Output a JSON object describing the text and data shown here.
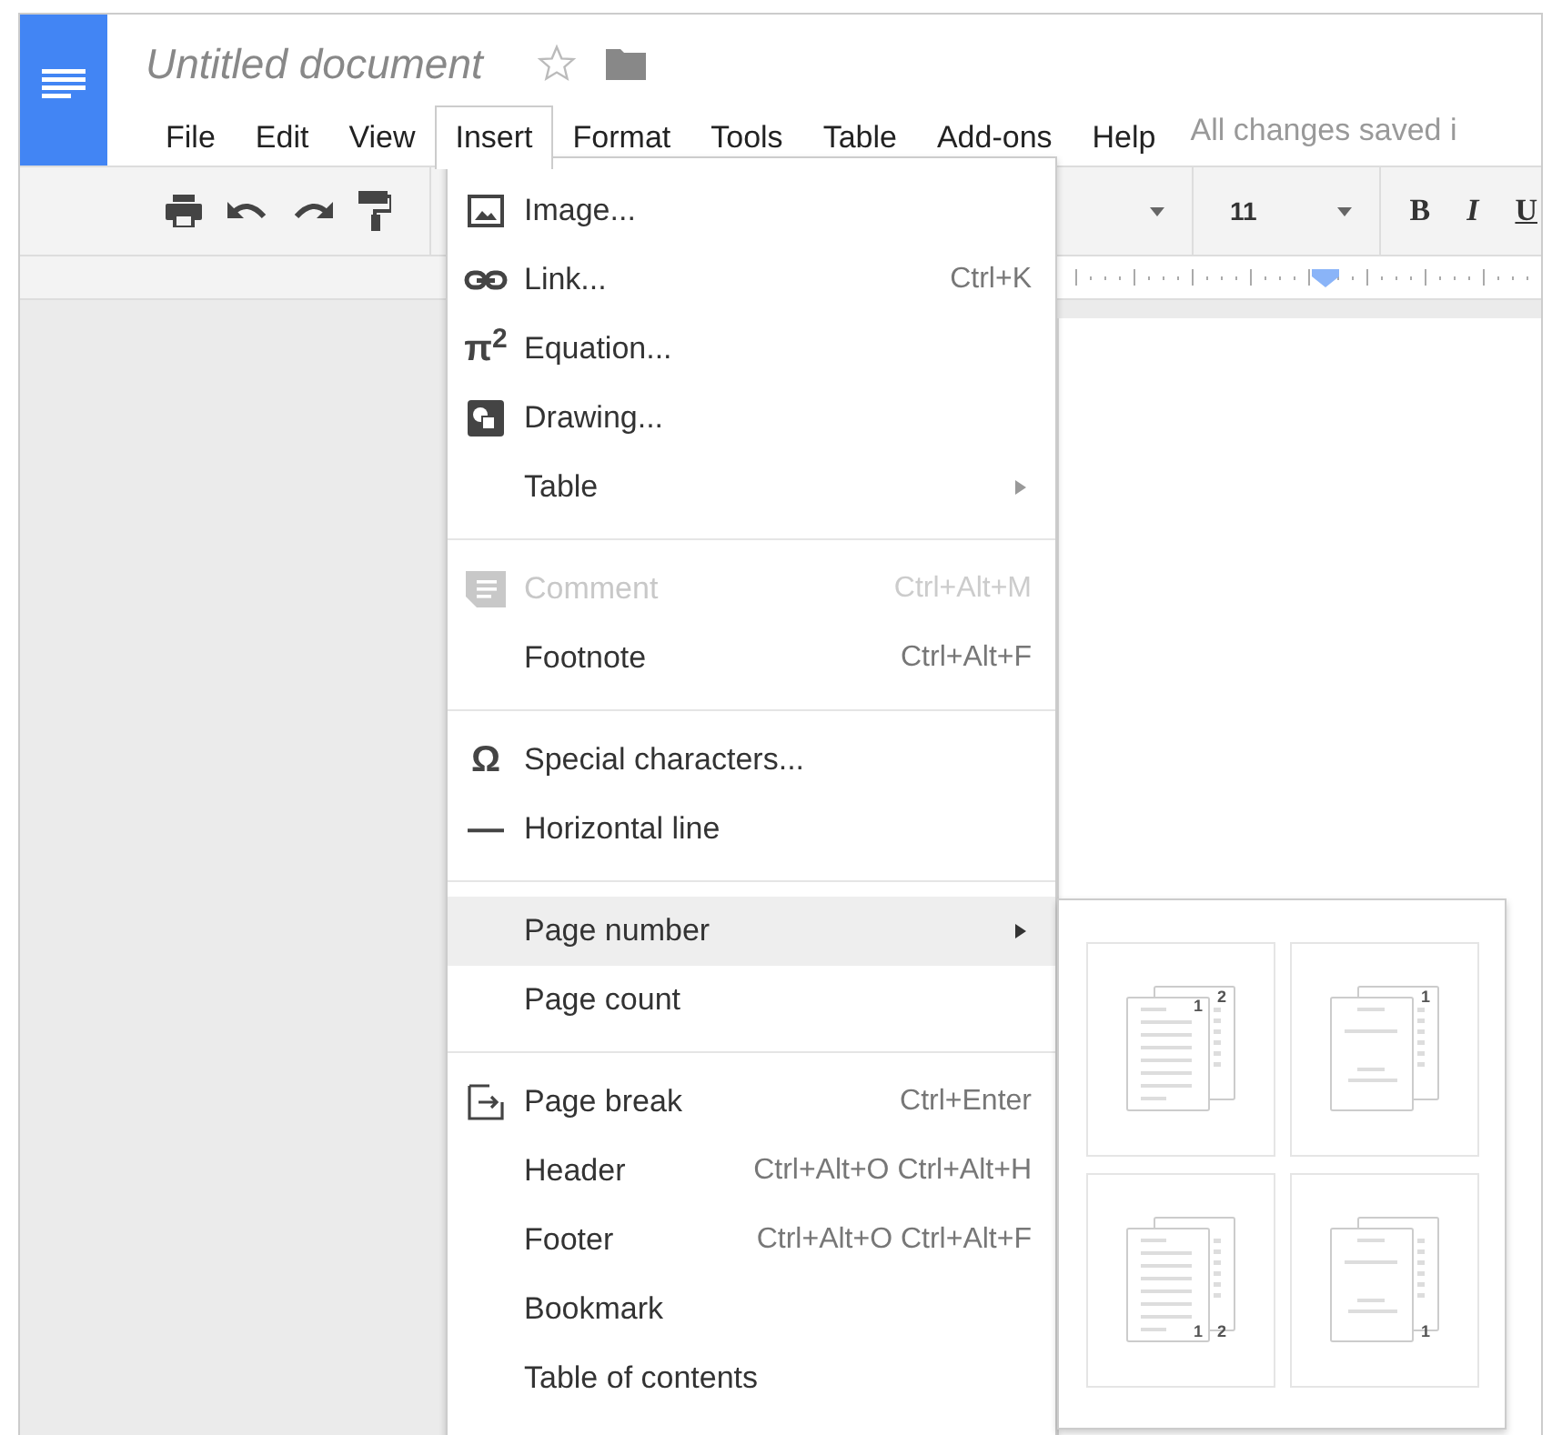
{
  "document": {
    "title": "Untitled document",
    "starred": false
  },
  "menu_bar": [
    {
      "label": "File",
      "selected": false
    },
    {
      "label": "Edit",
      "selected": false
    },
    {
      "label": "View",
      "selected": false
    },
    {
      "label": "Insert",
      "selected": true
    },
    {
      "label": "Format",
      "selected": false
    },
    {
      "label": "Tools",
      "selected": false
    },
    {
      "label": "Table",
      "selected": false
    },
    {
      "label": "Add-ons",
      "selected": false
    },
    {
      "label": "Help",
      "selected": false
    }
  ],
  "save_status": "All changes saved i",
  "toolbar": {
    "font_size": "11",
    "format_buttons": [
      {
        "label": "B",
        "kind": "bold"
      },
      {
        "label": "I",
        "kind": "italic"
      },
      {
        "label": "U",
        "kind": "underline"
      }
    ]
  },
  "insert_menu": [
    [
      {
        "label": "Image...",
        "kind": "image",
        "selected": false,
        "disabled": false,
        "submenu": false
      },
      {
        "label": "Link...",
        "kind": "link",
        "shortcut": "Ctrl+K",
        "selected": false,
        "disabled": false,
        "submenu": false
      },
      {
        "label": "Equation...",
        "kind": "glyph",
        "glyph": "π$^{2}$",
        "selected": false,
        "disabled": false,
        "submenu": false
      },
      {
        "label": "Drawing...",
        "kind": "drawing",
        "selected": false,
        "disabled": false,
        "submenu": false
      },
      {
        "label": "Table",
        "kind": "plain",
        "selected": false,
        "disabled": false,
        "submenu": true
      }
    ],
    [
      {
        "label": "Comment",
        "kind": "comment",
        "shortcut": "Ctrl+Alt+M",
        "selected": false,
        "disabled": true,
        "submenu": false
      },
      {
        "label": "Footnote",
        "kind": "plain",
        "shortcut": "Ctrl+Alt+F",
        "selected": false,
        "disabled": false,
        "submenu": false
      }
    ],
    [
      {
        "label": "Special characters...",
        "kind": "glyph",
        "glyph": "Ω",
        "selected": false,
        "disabled": false,
        "submenu": false
      },
      {
        "label": "Horizontal line",
        "kind": "glyph",
        "glyph": "—",
        "selected": false,
        "disabled": false,
        "submenu": false
      }
    ],
    [
      {
        "label": "Page number",
        "kind": "plain",
        "selected": true,
        "disabled": false,
        "submenu": true
      },
      {
        "label": "Page count",
        "kind": "plain",
        "selected": false,
        "disabled": false,
        "submenu": false
      }
    ],
    [
      {
        "label": "Page break",
        "kind": "pagebreak",
        "shortcut": "Ctrl+Enter",
        "selected": false,
        "disabled": false,
        "submenu": false
      },
      {
        "label": "Header",
        "kind": "plain",
        "shortcut": "Ctrl+Alt+O Ctrl+Alt+H",
        "selected": false,
        "disabled": false,
        "submenu": false
      },
      {
        "label": "Footer",
        "kind": "plain",
        "shortcut": "Ctrl+Alt+O Ctrl+Alt+F",
        "selected": false,
        "disabled": false,
        "submenu": false
      },
      {
        "label": "Bookmark",
        "kind": "plain",
        "selected": false,
        "disabled": false,
        "submenu": false
      },
      {
        "label": "Table of contents",
        "kind": "plain",
        "selected": false,
        "disabled": false,
        "submenu": false
      }
    ]
  ],
  "page_number_options": [
    {
      "kind": "topall",
      "first_page_label": "1",
      "second_page_label": "2"
    },
    {
      "kind": "topskip",
      "second_page_label": "1"
    },
    {
      "kind": "bottomall",
      "first_page_label": "1",
      "second_page_label": "2"
    },
    {
      "kind": "bottomskip",
      "second_page_label": "1"
    }
  ]
}
